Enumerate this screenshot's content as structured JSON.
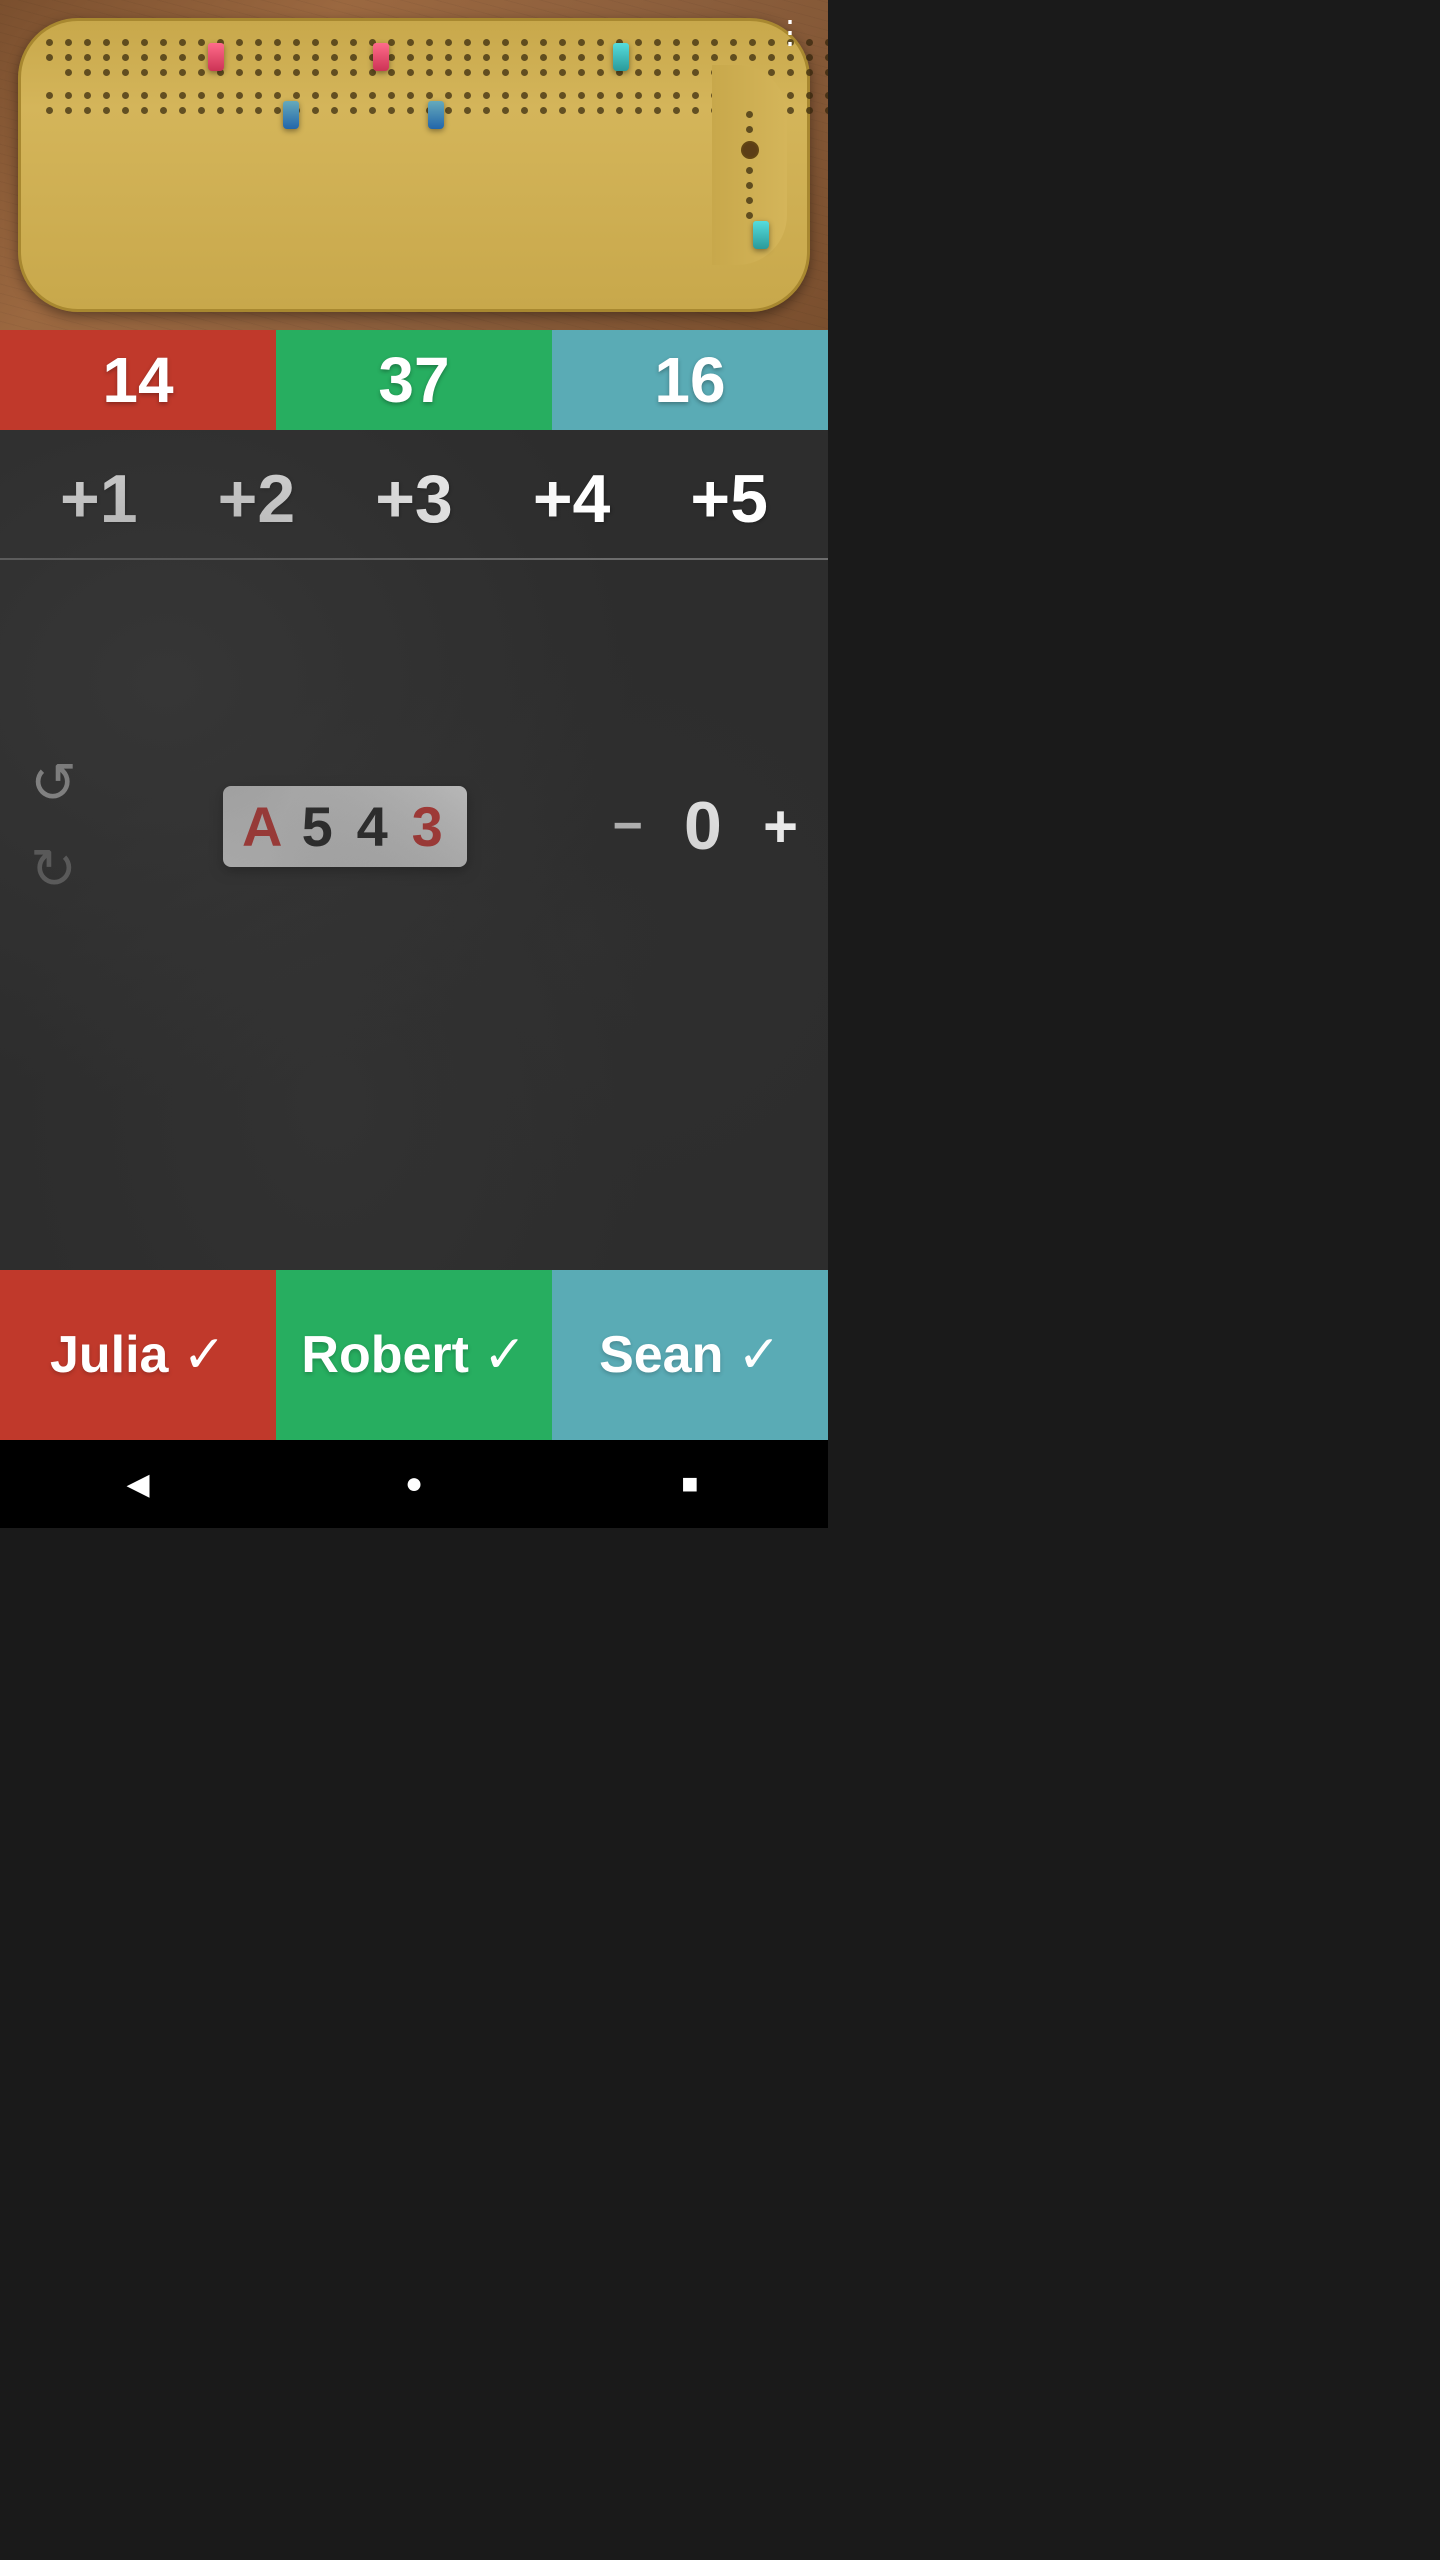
{
  "board": {
    "title": "Cribbage Board"
  },
  "scores": {
    "julia": "14",
    "robert": "37",
    "sean": "16"
  },
  "quickAdd": {
    "buttons": [
      "+1",
      "+2",
      "+3",
      "+4",
      "+5"
    ]
  },
  "cards": {
    "letters": [
      "A",
      "5",
      "4",
      "3"
    ],
    "colors": [
      "red",
      "black",
      "black",
      "red"
    ]
  },
  "counter": {
    "value": "0",
    "minusLabel": "−",
    "plusLabel": "+"
  },
  "undo": {
    "undoLabel": "↺",
    "redoLabel": "↻"
  },
  "players": {
    "julia": {
      "name": "Julia",
      "checkmark": "✓"
    },
    "robert": {
      "name": "Robert",
      "checkmark": "✓"
    },
    "sean": {
      "name": "Sean",
      "checkmark": "✓"
    }
  },
  "menu": {
    "icon": "⋮"
  },
  "navbar": {
    "back": "◀",
    "home": "●",
    "recent": "■"
  }
}
